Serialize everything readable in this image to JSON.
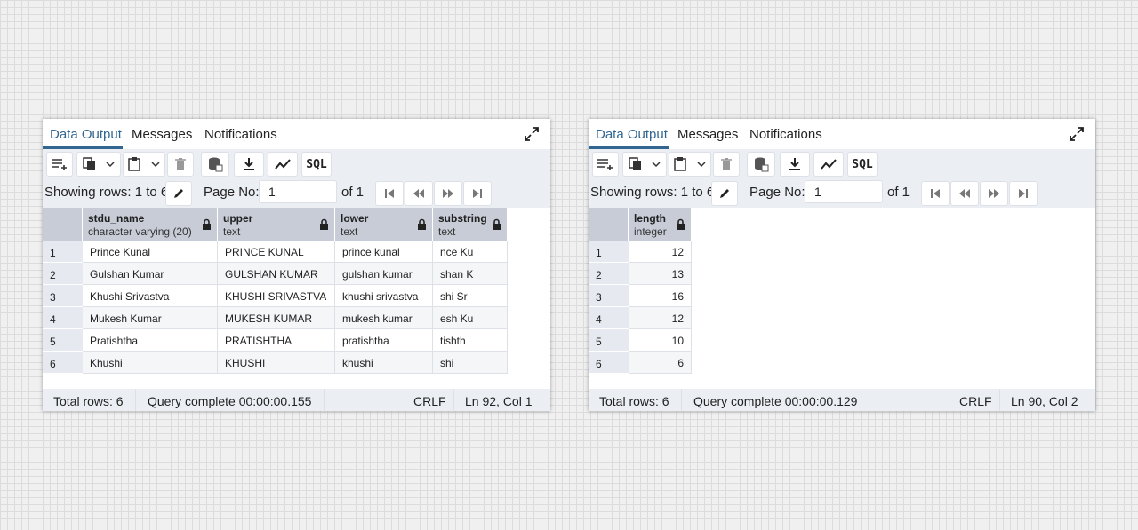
{
  "left": {
    "tabs": [
      "Data Output",
      "Messages",
      "Notifications"
    ],
    "row_info": "Showing rows: 1 to 6",
    "page_label": "Page No:",
    "page_value": "1",
    "page_of": "of 1",
    "columns": [
      {
        "name": "stdu_name",
        "type": "character varying (20)"
      },
      {
        "name": "upper",
        "type": "text"
      },
      {
        "name": "lower",
        "type": "text"
      },
      {
        "name": "substring",
        "type": "text"
      }
    ],
    "rows": [
      {
        "n": "1",
        "c": [
          "Prince Kunal",
          "PRINCE KUNAL",
          "prince kunal",
          "nce Ku"
        ]
      },
      {
        "n": "2",
        "c": [
          "Gulshan Kumar",
          "GULSHAN KUMAR",
          "gulshan kumar",
          "shan K"
        ]
      },
      {
        "n": "3",
        "c": [
          "Khushi Srivastva",
          "KHUSHI SRIVASTVA",
          "khushi srivastva",
          "shi Sr"
        ]
      },
      {
        "n": "4",
        "c": [
          "Mukesh Kumar",
          "MUKESH KUMAR",
          "mukesh kumar",
          "esh Ku"
        ]
      },
      {
        "n": "5",
        "c": [
          "Pratishtha",
          "PRATISHTHA",
          "pratishtha",
          "tishth"
        ]
      },
      {
        "n": "6",
        "c": [
          "Khushi",
          "KHUSHI",
          "khushi",
          "shi"
        ]
      }
    ],
    "status": {
      "total": "Total rows: 6",
      "query": "Query complete 00:00:00.155",
      "eol": "CRLF",
      "pos": "Ln 92, Col 1"
    }
  },
  "right": {
    "tabs": [
      "Data Output",
      "Messages",
      "Notifications"
    ],
    "row_info": "Showing rows: 1 to 6",
    "page_label": "Page No:",
    "page_value": "1",
    "page_of": "of 1",
    "columns": [
      {
        "name": "length",
        "type": "integer"
      }
    ],
    "rows": [
      {
        "n": "1",
        "c": [
          "12"
        ]
      },
      {
        "n": "2",
        "c": [
          "13"
        ]
      },
      {
        "n": "3",
        "c": [
          "16"
        ]
      },
      {
        "n": "4",
        "c": [
          "12"
        ]
      },
      {
        "n": "5",
        "c": [
          "10"
        ]
      },
      {
        "n": "6",
        "c": [
          "6"
        ]
      }
    ],
    "status": {
      "total": "Total rows: 6",
      "query": "Query complete 00:00:00.129",
      "eol": "CRLF",
      "pos": "Ln 90, Col 2"
    }
  },
  "toolbar_sql_label": "SQL",
  "icons": [
    "add-row-icon",
    "copy-icon",
    "chevron-down-icon",
    "paste-icon",
    "delete-icon",
    "save-data-icon",
    "download-icon",
    "graph-icon",
    "edit-icon",
    "first-page-icon",
    "prev-page-icon",
    "next-page-icon",
    "last-page-icon",
    "lock-icon",
    "expand-icon"
  ],
  "colors": {
    "accent": "#326690",
    "header_bg": "#c7ccd7",
    "toolbar_bg": "#ebeef3"
  }
}
